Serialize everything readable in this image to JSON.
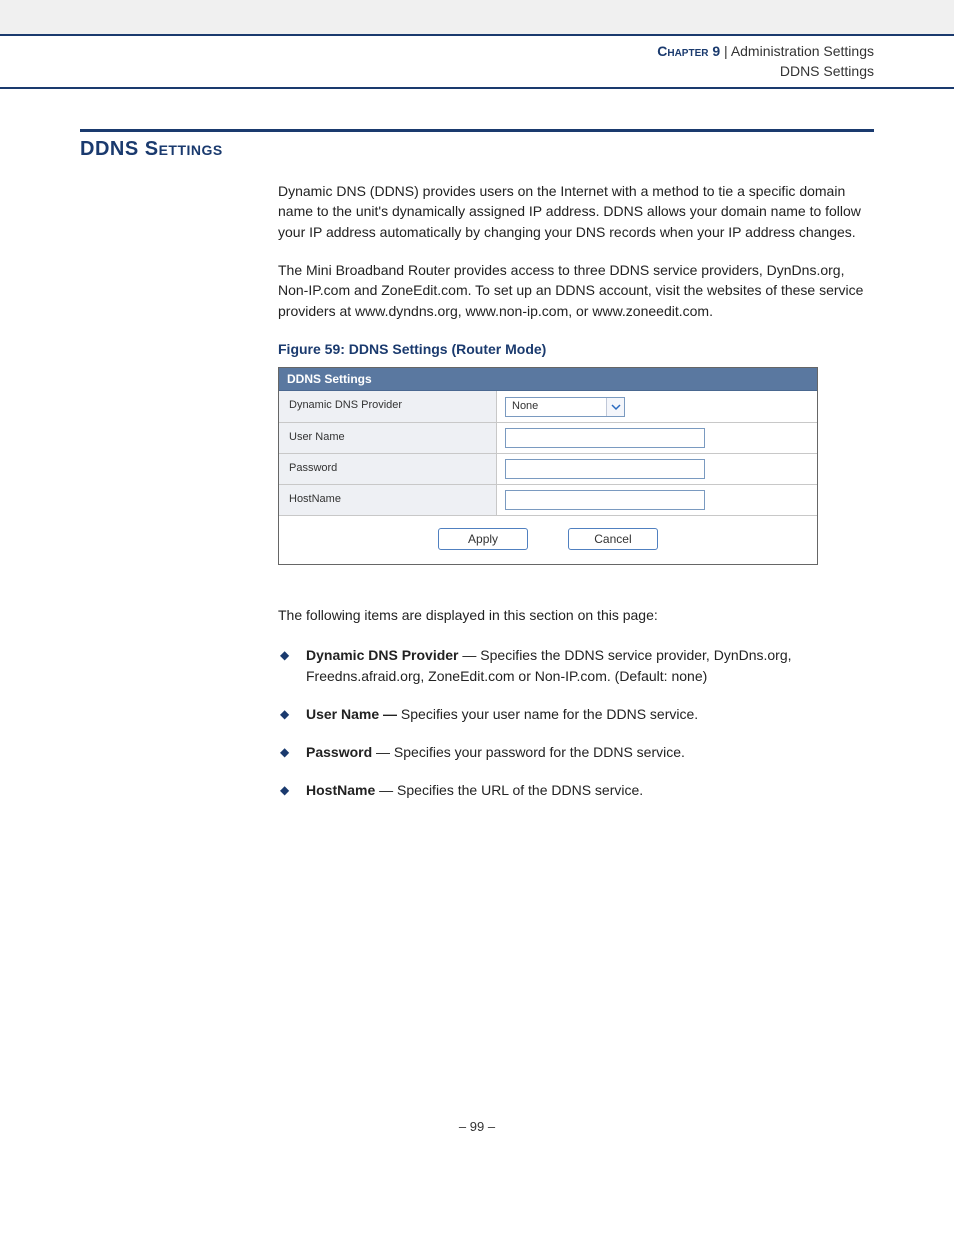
{
  "header": {
    "chapter": "Chapter 9",
    "sep": "  |  ",
    "trail": "Administration Settings",
    "sub": "DDNS Settings"
  },
  "section": {
    "title": "DDNS Settings",
    "para1": "Dynamic DNS (DDNS) provides users on the Internet with a method to tie a specific domain name to the unit's dynamically assigned IP address. DDNS allows your domain name to follow your IP address automatically by changing your DNS records when your IP address changes.",
    "para2": "The Mini Broadband Router provides access to three DDNS service providers, DynDns.org, Non-IP.com and ZoneEdit.com. To set up an DDNS account, visit the websites of these service providers at www.dyndns.org, www.non-ip.com, or www.zoneedit.com."
  },
  "figure": {
    "caption": "Figure 59:  DDNS Settings (Router Mode)",
    "panel_title": "DDNS Settings",
    "rows": {
      "provider_label": "Dynamic DNS Provider",
      "provider_value": "None",
      "username_label": "User Name",
      "username_value": "",
      "password_label": "Password",
      "password_value": "",
      "hostname_label": "HostName",
      "hostname_value": ""
    },
    "buttons": {
      "apply": "Apply",
      "cancel": "Cancel"
    }
  },
  "items": {
    "intro": "The following items are displayed in this section on this page:",
    "b1_label": "Dynamic DNS Provider",
    "b1_text": " — Specifies the DDNS service provider, DynDns.org, Freedns.afraid.org, ZoneEdit.com or Non-IP.com. (Default: none)",
    "b2_label": "User Name —",
    "b2_text": " Specifies your user name for the DDNS service.",
    "b3_label": "Password",
    "b3_text": " — Specifies your password for the DDNS service.",
    "b4_label": "HostName",
    "b4_text": " — Specifies the URL of the DDNS service."
  },
  "footer": {
    "page": "–  99  –"
  }
}
